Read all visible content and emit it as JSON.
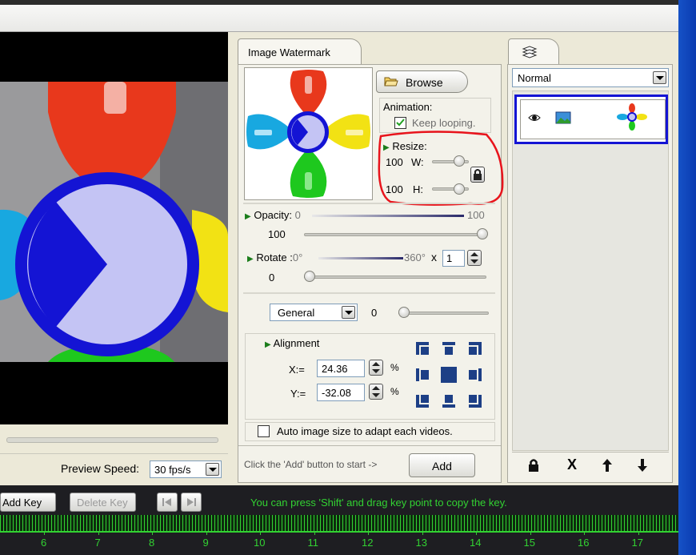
{
  "preview": {
    "speed_label": "Preview Speed:",
    "speed_value": "30 fps/s"
  },
  "watermark_panel": {
    "tab_label": "Image Watermark",
    "browse_label": "Browse",
    "animation_label": "Animation:",
    "keep_looping_label": "Keep looping.",
    "keep_looping_checked": true,
    "resize_label": "Resize:",
    "width_value": "100",
    "width_label": "W:",
    "height_value": "100",
    "height_label": "H:",
    "opacity_label": "Opacity:",
    "opacity_min": "0",
    "opacity_max": "100",
    "opacity_value": "100",
    "rotate_label": "Rotate :",
    "rotate_min": "0°",
    "rotate_max": "360°",
    "rotate_multiplier_symbol": "x",
    "rotate_multiplier": "1",
    "rotate_value": "0",
    "mode_value": "General",
    "mode_slider_value": "0",
    "alignment_label": "Alignment",
    "x_label": "X:=",
    "x_value": "24.36",
    "y_label": "Y:=",
    "y_value": "-32.08",
    "percent": "%",
    "auto_size_label": "Auto image size to adapt each videos.",
    "auto_size_checked": false,
    "hint_text": "Click the 'Add' button to start ->",
    "add_label": "Add"
  },
  "layers_panel": {
    "blend_mode": "Normal",
    "tools": [
      "lock-icon",
      "delete-icon",
      "move-up-icon",
      "move-down-icon"
    ],
    "delete_label": "X"
  },
  "timeline": {
    "add_key_label": "Add Key",
    "delete_key_label": "Delete Key",
    "hint": "You can press 'Shift' and drag key point to copy the key.",
    "ticks": [
      "6",
      "7",
      "8",
      "9",
      "10",
      "11",
      "12",
      "13",
      "14",
      "15",
      "16",
      "17"
    ]
  },
  "colors": {
    "accent_red": "#e8381c",
    "accent_blue": "#1414d4",
    "pie_fill": "#c4c4f4",
    "petal_yellow": "#f2e214",
    "petal_green": "#1ec81e",
    "petal_cyan": "#18a8e0",
    "timeline_green": "#32d232",
    "annotation_red": "#e8141c"
  }
}
